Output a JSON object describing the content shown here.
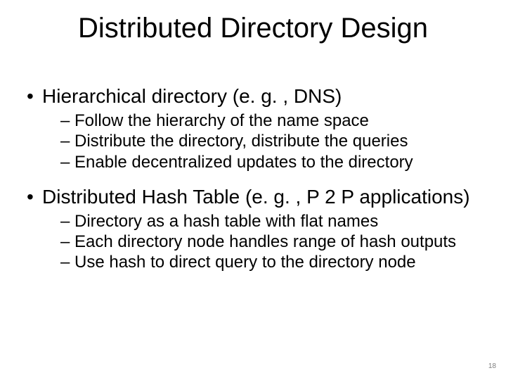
{
  "title": "Distributed Directory Design",
  "bullets": {
    "b1": {
      "text": "Hierarchical directory (e. g. , DNS)",
      "sub": [
        "– Follow the hierarchy of the name space",
        "– Distribute the directory, distribute the queries",
        "– Enable decentralized updates to the directory"
      ]
    },
    "b2": {
      "text": "Distributed Hash Table (e. g. , P 2 P applications)",
      "sub": [
        "– Directory as a hash table with flat names",
        "– Each directory node handles range of hash outputs",
        "– Use hash to direct query to the directory node"
      ]
    }
  },
  "slide_number": "18"
}
